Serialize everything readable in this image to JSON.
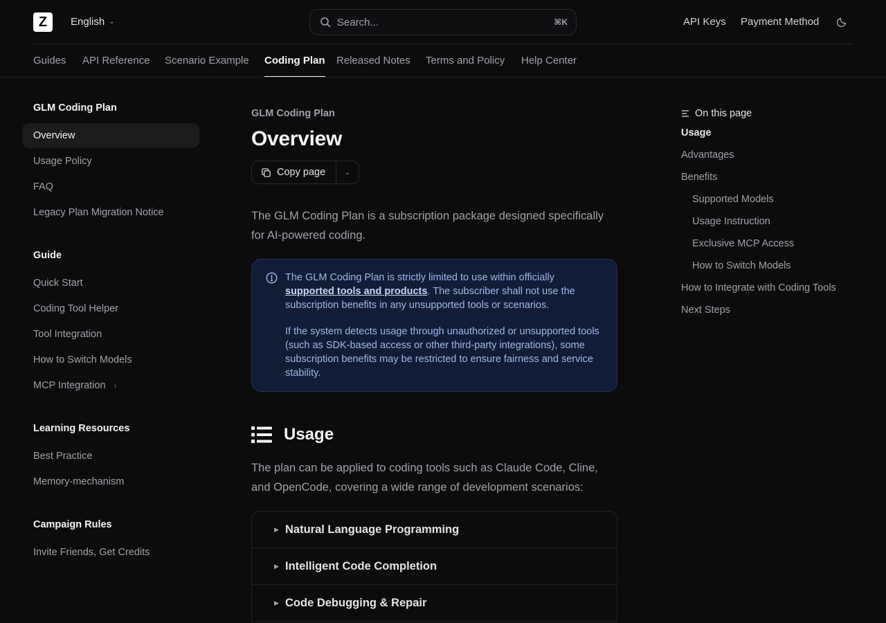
{
  "header": {
    "logo_letter": "Z",
    "language": "English",
    "search_placeholder": "Search...",
    "search_shortcut": "⌘K",
    "links": [
      "API Keys",
      "Payment Method"
    ]
  },
  "nav": {
    "tabs": [
      "Guides",
      "API Reference",
      "Scenario Example",
      "Coding Plan",
      "Released Notes",
      "Terms and Policy",
      "Help Center"
    ],
    "active_tab": "Coding Plan"
  },
  "sidebar": {
    "sections": [
      {
        "title": "GLM Coding Plan",
        "items": [
          "Overview",
          "Usage Policy",
          "FAQ",
          "Legacy Plan Migration Notice"
        ]
      },
      {
        "title": "Guide",
        "items": [
          "Quick Start",
          "Coding Tool Helper",
          "Tool Integration",
          "How to Switch Models",
          "MCP Integration"
        ]
      },
      {
        "title": "Learning Resources",
        "items": [
          "Best Practice",
          "Memory-mechanism"
        ]
      },
      {
        "title": "Campaign Rules",
        "items": [
          "Invite Friends, Get Credits"
        ]
      }
    ],
    "active_item": "Overview"
  },
  "main": {
    "eyebrow": "GLM Coding Plan",
    "title": "Overview",
    "copy_label": "Copy page",
    "lead": "The GLM Coding Plan is a subscription package designed specifically for AI-powered coding.",
    "notice": {
      "p1_before": "The GLM Coding Plan is strictly limited to use within officially ",
      "p1_link": "supported tools and products",
      "p1_after": ". The subscriber shall not use the subscription benefits in any unsupported tools or scenarios.",
      "p2": "If the system detects usage through unauthorized or unsupported tools (such as SDK-based access or other third-party integrations), some subscription benefits may be restricted to ensure fairness and service stability."
    },
    "usage_heading": "Usage",
    "usage_text": "The plan can be applied to coding tools such as Claude Code, Cline, and OpenCode, covering a wide range of development scenarios:",
    "accordion": [
      "Natural Language Programming",
      "Intelligent Code Completion",
      "Code Debugging & Repair"
    ]
  },
  "toc": {
    "heading": "On this page",
    "items": [
      {
        "label": "Usage",
        "indent": false,
        "active": true
      },
      {
        "label": "Advantages",
        "indent": false,
        "active": false
      },
      {
        "label": "Benefits",
        "indent": false,
        "active": false
      },
      {
        "label": "Supported Models",
        "indent": true,
        "active": false
      },
      {
        "label": "Usage Instruction",
        "indent": true,
        "active": false
      },
      {
        "label": "Exclusive MCP Access",
        "indent": true,
        "active": false
      },
      {
        "label": "How to Switch Models",
        "indent": true,
        "active": false
      },
      {
        "label": "How to Integrate with Coding Tools",
        "indent": false,
        "active": false
      },
      {
        "label": "Next Steps",
        "indent": false,
        "active": false
      }
    ]
  }
}
